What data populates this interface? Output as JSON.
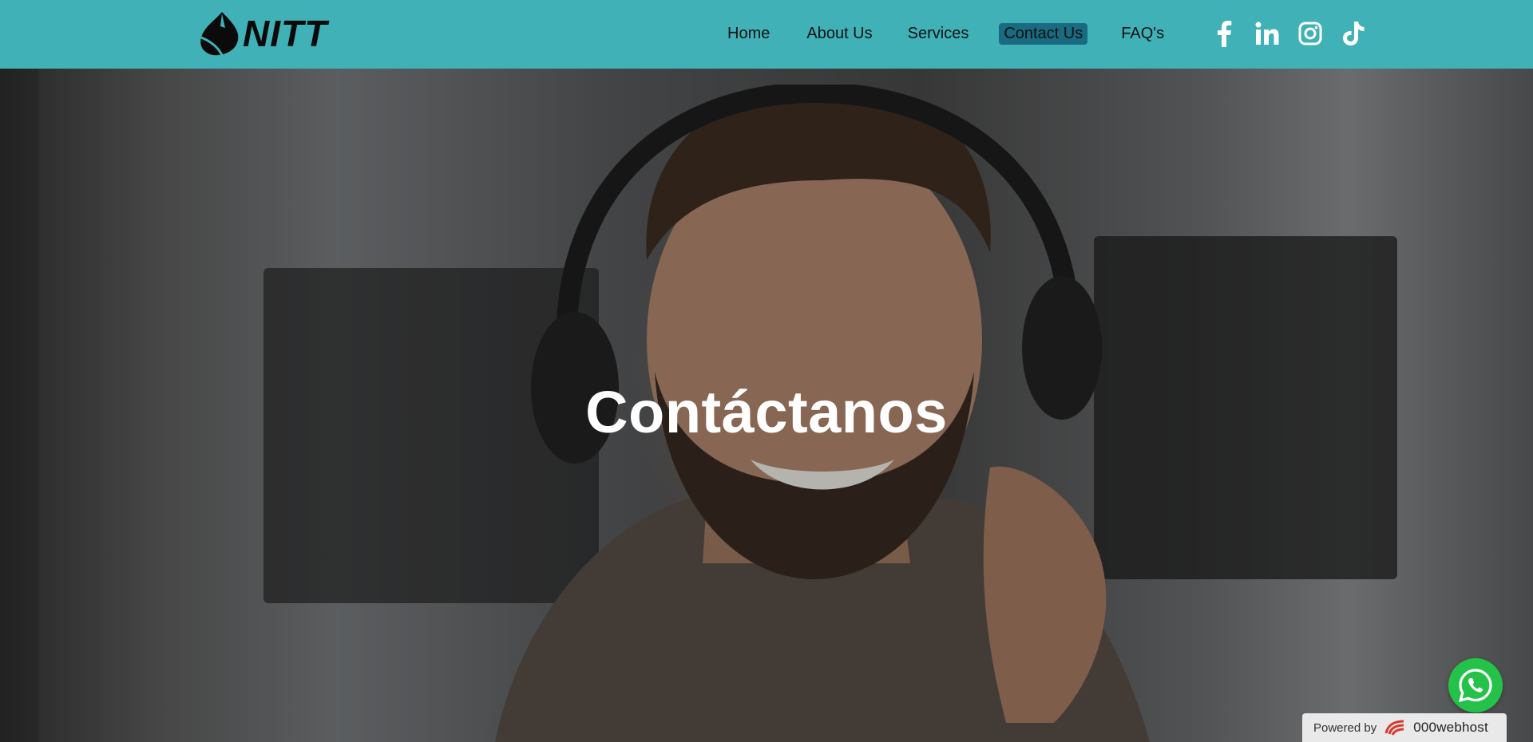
{
  "brand": {
    "name": "NITT",
    "logo_icon": "teardrop-leaf-icon"
  },
  "nav": {
    "items": [
      {
        "label": "Home",
        "active": false
      },
      {
        "label": "About Us",
        "active": false
      },
      {
        "label": "Services",
        "active": false
      },
      {
        "label": "Contact Us",
        "active": true
      },
      {
        "label": "FAQ's",
        "active": false
      }
    ]
  },
  "socials": [
    {
      "name": "facebook-icon"
    },
    {
      "name": "linkedin-icon"
    },
    {
      "name": "instagram-icon"
    },
    {
      "name": "tiktok-icon"
    }
  ],
  "hero": {
    "title": "Contáctanos",
    "image": "smiling-man-with-headphones-photo"
  },
  "whatsapp": {
    "icon": "whatsapp-icon"
  },
  "footer_badge": {
    "label": "Powered by",
    "brand": "000webhost"
  },
  "colors": {
    "navbar": "#40b1b6",
    "active_nav": "#1a6b81",
    "whatsapp": "#25c24a",
    "hero_text": "#ffffff"
  }
}
